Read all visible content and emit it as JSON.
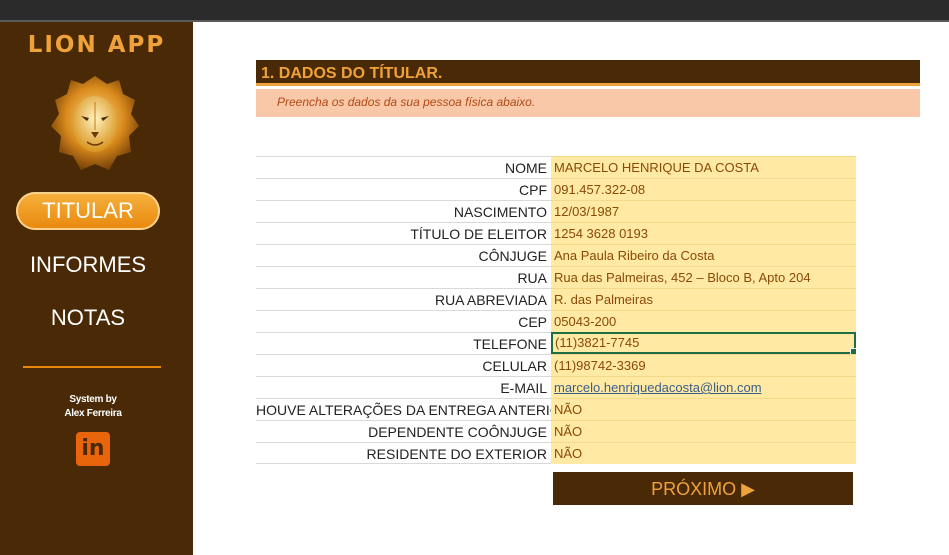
{
  "sidebar": {
    "app_title": "LION APP",
    "logo_icon": "lion-head-icon",
    "nav": [
      {
        "label": "TITULAR",
        "active": true
      },
      {
        "label": "INFORMES",
        "active": false
      },
      {
        "label": "NOTAS",
        "active": false
      }
    ],
    "credit_line1": "System by",
    "credit_line2": "Alex Ferreira",
    "linkedin_text": "in",
    "linkedin_icon": "linkedin-icon"
  },
  "header": {
    "title": "1. DADOS DO TÍTULAR.",
    "subtitle": "Preencha os dados da sua pessoa física abaixo."
  },
  "form": {
    "rows": [
      {
        "label": "NOME",
        "value": "MARCELO HENRIQUE DA COSTA"
      },
      {
        "label": "CPF",
        "value": "091.457.322-08"
      },
      {
        "label": "NASCIMENTO",
        "value": "12/03/1987"
      },
      {
        "label": "TÍTULO DE ELEITOR",
        "value": "1254 3628 0193"
      },
      {
        "label": "CÔNJUGE",
        "value": "Ana Paula Ribeiro da Costa"
      },
      {
        "label": "RUA",
        "value": "Rua das Palmeiras, 452 – Bloco B, Apto 204"
      },
      {
        "label": "RUA ABREVIADA",
        "value": "R. das Palmeiras"
      },
      {
        "label": "CEP",
        "value": "05043-200"
      },
      {
        "label": "TELEFONE",
        "value": "(11)3821-7745"
      },
      {
        "label": "CELULAR",
        "value": "(11)98742-3369"
      },
      {
        "label": "E-MAIL",
        "value": "marcelo.henriquedacosta@lion.com"
      },
      {
        "label": "HOUVE ALTERAÇÕES DA ENTREGA ANTERIOR",
        "value": "NÃO"
      },
      {
        "label": "DEPENDENTE COÔNJUGE",
        "value": "NÃO"
      },
      {
        "label": "RESIDENTE DO EXTERIOR",
        "value": "NÃO"
      }
    ]
  },
  "actions": {
    "next_label": "PRÓXIMO ▶",
    "next_icon": "play-arrow-icon"
  },
  "colors": {
    "sidebar_bg": "#4a2a06",
    "accent": "#f0a23a",
    "field_bg": "#ffe9a3",
    "subtitle_bg": "#f8c8a8"
  }
}
